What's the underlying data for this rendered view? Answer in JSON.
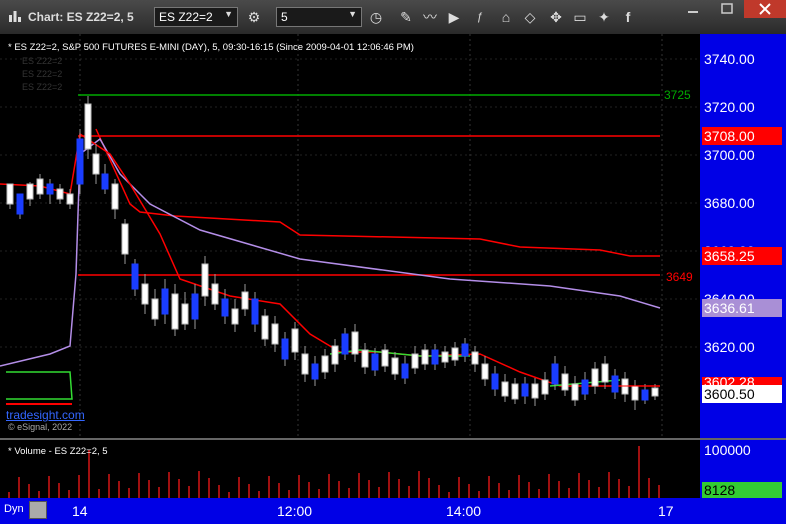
{
  "window": {
    "title": "Chart: ES Z22=2, 5"
  },
  "toolbar": {
    "symbol_value": "ES Z22=2",
    "interval_value": "5",
    "tools": [
      "clock-icon",
      "pencil-icon",
      "draw-line-icon",
      "play-icon",
      "fx-icon",
      "tag-icon",
      "eraser-icon",
      "comment-icon",
      "twitter-icon",
      "facebook-icon"
    ]
  },
  "chart": {
    "header": "* ES Z22=2, S&P 500 FUTURES E-MINI (DAY), 5, 09:30-16:15 (Since 2009-04-01 12:06:46 PM)",
    "ghost_lines": [
      "ES Z22=2",
      "ES Z22=2",
      "ES Z22=2"
    ],
    "watermark": "tradesight.com",
    "copyright": "© eSignal, 2022",
    "line_labels": {
      "green_level": "3725",
      "red_level": "3649"
    },
    "price_ticks": [
      "3740.00",
      "3720.00",
      "3700.00",
      "3680.00",
      "3660.00",
      "3640.00",
      "3620.00"
    ],
    "badges": [
      {
        "text": "3708.00",
        "bg": "#ff0000",
        "fg": "#ffffff"
      },
      {
        "text": "3658.25",
        "bg": "#ff0000",
        "fg": "#ffffff"
      },
      {
        "text": "3636.61",
        "bg": "#a98fd6",
        "fg": "#ffffff"
      },
      {
        "text": "3602.28",
        "bg": "#ff0000",
        "fg": "#ffffff"
      },
      {
        "text": "3600.50",
        "bg": "#ffffff",
        "fg": "#000000"
      }
    ]
  },
  "volume": {
    "title": "* Volume - ES Z22=2, 5",
    "tick": "100000",
    "current": "8128",
    "current_bg": "#33cc33"
  },
  "time_axis": {
    "labels": [
      "14",
      "12:00",
      "14:00",
      "17"
    ],
    "dyn_label": "Dyn"
  },
  "colors": {
    "green": "#00aa00",
    "red": "#ff0000",
    "purple": "#b48ee8",
    "axis_bg": "#0000e6"
  }
}
